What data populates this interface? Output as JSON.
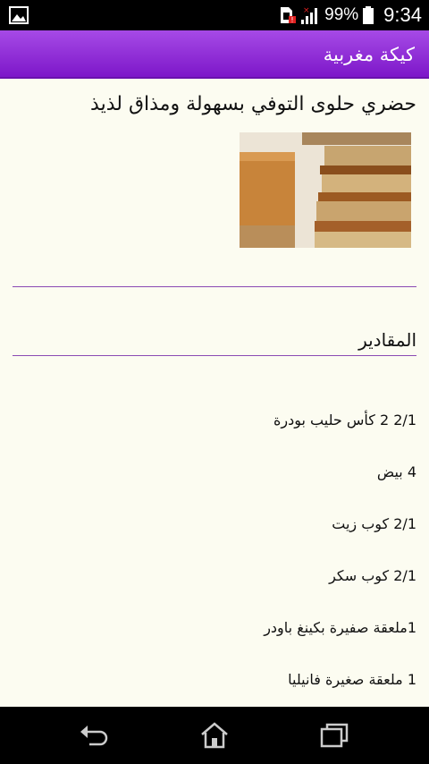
{
  "status_bar": {
    "battery_percent": "99%",
    "time": "9:34",
    "icons": [
      "gallery-notification-icon",
      "sim-error-icon",
      "signal-icon",
      "battery-icon"
    ]
  },
  "action_bar": {
    "title": "كيكة مغربية"
  },
  "article": {
    "headline": "حضري حلوى التوفي بسهولة ومذاق لذيذ",
    "photo": "toffee-cake-photo"
  },
  "ingredients_section": {
    "title": "المقادير",
    "items": [
      "2/1 2 كأس حليب بودرة",
      "4 بيض",
      "2/1 كوب زيت",
      "2/1 كوب سكر",
      "1ملعقة صفيرة بكينغ باودر",
      "1 ملعقة صغيرة فانيليا"
    ]
  },
  "nav_bar": {
    "buttons": [
      "back-icon",
      "home-icon",
      "recents-icon"
    ]
  },
  "colors": {
    "accent": "#7d17c9",
    "divider": "#8a4ab3",
    "background": "#fcfcf1"
  }
}
